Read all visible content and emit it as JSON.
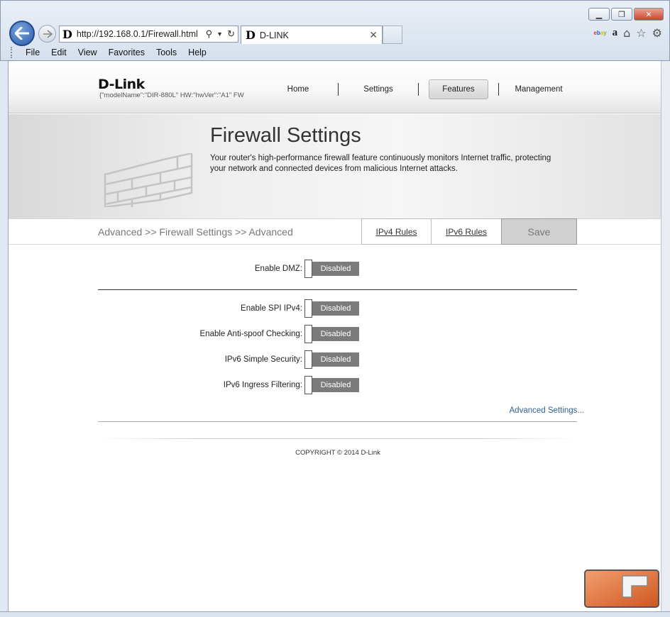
{
  "browser": {
    "url": "http://192.168.0.1/Firewall.html",
    "tab_title": "D-LINK",
    "favicon_letter": "D",
    "menu": [
      "File",
      "Edit",
      "View",
      "Favorites",
      "Tools",
      "Help"
    ],
    "icons": [
      "back-icon",
      "forward-icon",
      "search-icon",
      "dropdown-icon",
      "refresh-icon",
      "close-tab-icon",
      "ebay-icon",
      "amazon-icon",
      "home-icon",
      "star-icon",
      "gear-icon",
      "minimize-icon",
      "restore-icon",
      "close-icon"
    ],
    "ebay_text": {
      "e": "e",
      "b": "b",
      "a": "a",
      "y": "y"
    },
    "amazon_text": "a"
  },
  "header": {
    "logo": "D-Link",
    "hwinfo": "{\"modelName\":\"DIR-880L\"   HW:\"hwVer\":\"A1\"   FW",
    "nav": [
      {
        "label": "Home"
      },
      {
        "label": "Settings"
      },
      {
        "label": "Features"
      },
      {
        "label": "Management"
      }
    ]
  },
  "banner": {
    "title": "Firewall Settings",
    "description": "Your router's high-performance firewall feature continuously monitors Internet traffic, protecting your network and connected devices from malicious Internet attacks."
  },
  "toolbar": {
    "breadcrumb": "Advanced >> Firewall Settings >> Advanced",
    "ipv4_rules": "IPv4 Rules",
    "ipv6_rules": "IPv6 Rules",
    "save": "Save"
  },
  "settings": [
    {
      "label": "Enable DMZ:",
      "state": "Disabled"
    },
    {
      "label": "Enable SPI IPv4:",
      "state": "Disabled"
    },
    {
      "label": "Enable Anti-spoof Checking:",
      "state": "Disabled"
    },
    {
      "label": "IPv6 Simple Security:",
      "state": "Disabled"
    },
    {
      "label": "IPv6 Ingress Filtering:",
      "state": "Disabled"
    }
  ],
  "advanced_link": "Advanced Settings...",
  "copyright": "COPYRIGHT © 2014 D-Link",
  "colors": {
    "accent": "#2a5aa8",
    "toggle_off": "#7b7b7b",
    "link": "#2f5f8f"
  }
}
